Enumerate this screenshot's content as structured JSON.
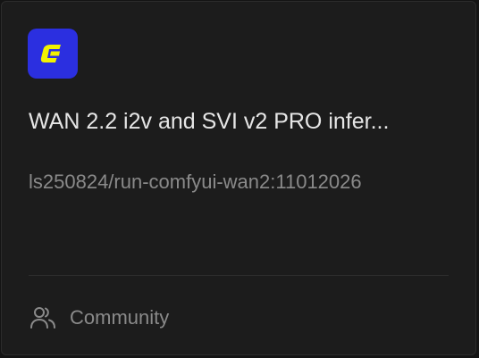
{
  "card": {
    "logo_icon": "comfy-logo-icon",
    "logo_bg": "#2b2fe0",
    "logo_fg": "#f2f200",
    "title": "WAN 2.2 i2v and SVI v2 PRO infer...",
    "subtitle": "ls250824/run-comfyui-wan2:11012026",
    "footer": {
      "icon": "users-icon",
      "label": "Community"
    }
  }
}
